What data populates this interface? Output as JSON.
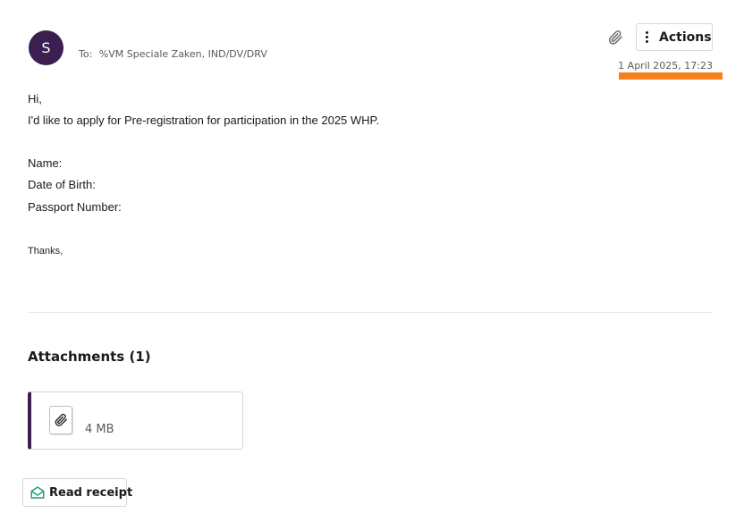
{
  "header": {
    "avatar_initial": "S",
    "to_label": "To:",
    "to_recipients": "%VM Speciale Zaken, IND/DV/DRV",
    "actions_label": "Actions",
    "timestamp": "1 April 2025, 17:23"
  },
  "icons": {
    "header_attachment": "paperclip-icon",
    "actions_menu": "kebab-icon",
    "attachment_file": "paperclip-icon",
    "read_receipt": "envelope-open-icon"
  },
  "colors": {
    "accent": "#3b1f4e",
    "highlight_marker": "#f5821f",
    "read_receipt_icon": "#1aa37a"
  },
  "message": {
    "greeting": "Hi,",
    "intro": "I'd like to apply for Pre-registration for participation in the 2025 WHP.",
    "fields": [
      "Name:",
      "Date of Birth:",
      "Passport Number:"
    ],
    "closing": "Thanks,"
  },
  "attachments": {
    "heading": "Attachments (1)",
    "items": [
      {
        "size": "4 MB"
      }
    ]
  },
  "footer": {
    "read_receipt_label": "Read receipt"
  }
}
